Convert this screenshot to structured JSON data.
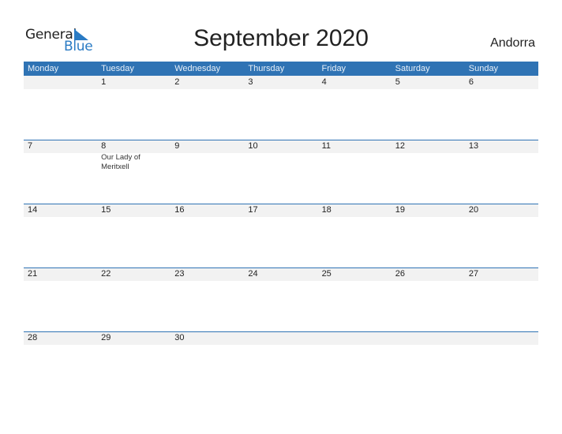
{
  "logo": {
    "word1": "General",
    "word2": "Blue"
  },
  "title": "September 2020",
  "country": "Andorra",
  "colors": {
    "header_bg": "#2f73b4",
    "strip_bg": "#f2f2f2",
    "logo_blue": "#2a7bc4"
  },
  "weekdays": [
    "Monday",
    "Tuesday",
    "Wednesday",
    "Thursday",
    "Friday",
    "Saturday",
    "Sunday"
  ],
  "weeks": [
    {
      "days": [
        {
          "num": "",
          "event": ""
        },
        {
          "num": "1",
          "event": ""
        },
        {
          "num": "2",
          "event": ""
        },
        {
          "num": "3",
          "event": ""
        },
        {
          "num": "4",
          "event": ""
        },
        {
          "num": "5",
          "event": ""
        },
        {
          "num": "6",
          "event": ""
        }
      ]
    },
    {
      "days": [
        {
          "num": "7",
          "event": ""
        },
        {
          "num": "8",
          "event": "Our Lady of Meritxell"
        },
        {
          "num": "9",
          "event": ""
        },
        {
          "num": "10",
          "event": ""
        },
        {
          "num": "11",
          "event": ""
        },
        {
          "num": "12",
          "event": ""
        },
        {
          "num": "13",
          "event": ""
        }
      ]
    },
    {
      "days": [
        {
          "num": "14",
          "event": ""
        },
        {
          "num": "15",
          "event": ""
        },
        {
          "num": "16",
          "event": ""
        },
        {
          "num": "17",
          "event": ""
        },
        {
          "num": "18",
          "event": ""
        },
        {
          "num": "19",
          "event": ""
        },
        {
          "num": "20",
          "event": ""
        }
      ]
    },
    {
      "days": [
        {
          "num": "21",
          "event": ""
        },
        {
          "num": "22",
          "event": ""
        },
        {
          "num": "23",
          "event": ""
        },
        {
          "num": "24",
          "event": ""
        },
        {
          "num": "25",
          "event": ""
        },
        {
          "num": "26",
          "event": ""
        },
        {
          "num": "27",
          "event": ""
        }
      ]
    },
    {
      "days": [
        {
          "num": "28",
          "event": ""
        },
        {
          "num": "29",
          "event": ""
        },
        {
          "num": "30",
          "event": ""
        },
        {
          "num": "",
          "event": ""
        },
        {
          "num": "",
          "event": ""
        },
        {
          "num": "",
          "event": ""
        },
        {
          "num": "",
          "event": ""
        }
      ]
    }
  ]
}
